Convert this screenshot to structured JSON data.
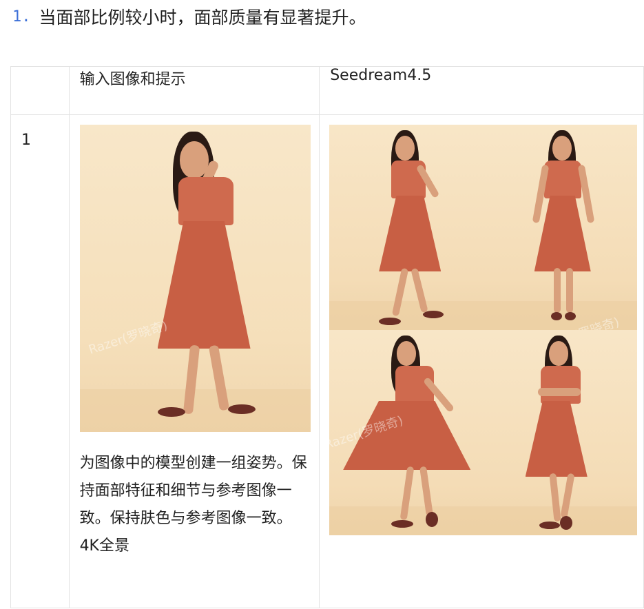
{
  "heading": {
    "number": "1.",
    "text": "当面部比例较小时，面部质量有显著提升。"
  },
  "table": {
    "headers": [
      "",
      "输入图像和提示",
      "Seedream4.5"
    ],
    "rows": [
      {
        "index": "1",
        "prompt": "为图像中的模型创建一组姿势。保持面部特征和细节与参考图像一致。保持肤色与参考图像一致。4K全景"
      }
    ]
  },
  "watermark": "Razer(罗晓奇)"
}
